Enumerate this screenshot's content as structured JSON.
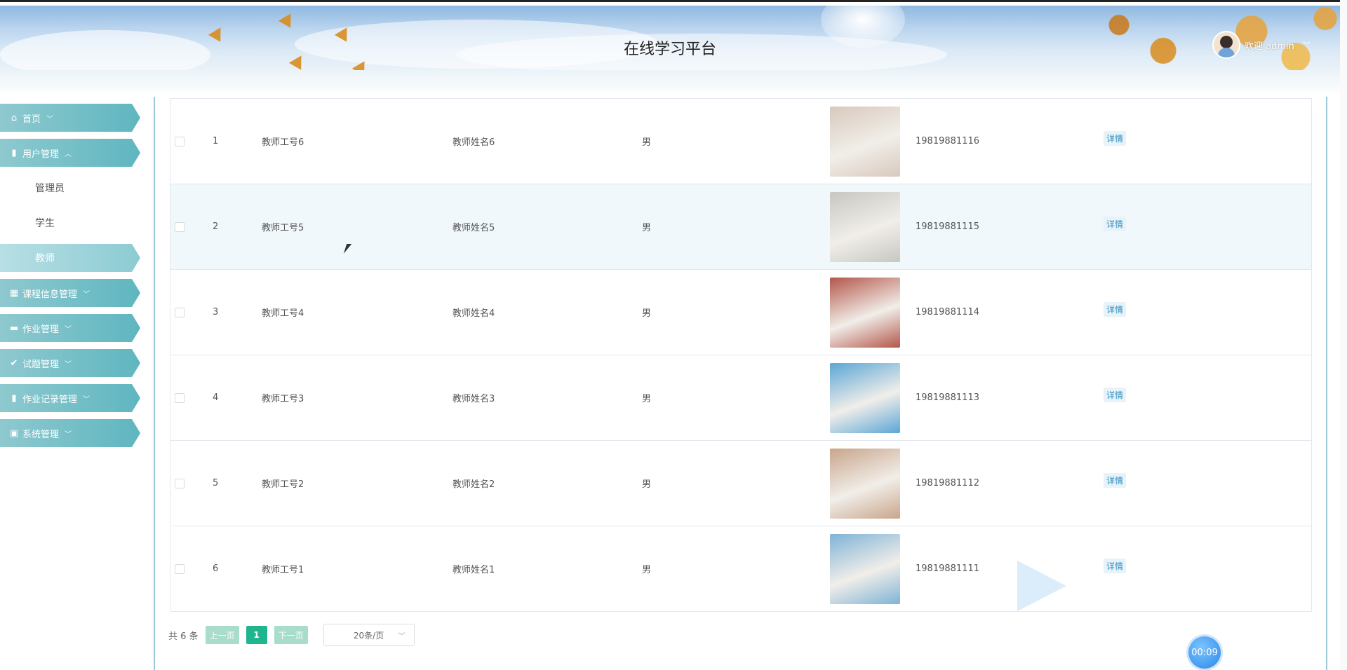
{
  "header": {
    "title": "在线学习平台",
    "welcome": "欢迎 admin"
  },
  "sidebar": {
    "items": [
      {
        "label": "首页",
        "icon": "home-icon"
      },
      {
        "label": "用户管理",
        "icon": "table-icon",
        "expanded": true,
        "children": [
          "管理员",
          "学生",
          "教师"
        ],
        "active_child": "教师"
      },
      {
        "label": "课程信息管理",
        "icon": "grid-icon"
      },
      {
        "label": "作业管理",
        "icon": "folder-icon"
      },
      {
        "label": "试题管理",
        "icon": "check-icon"
      },
      {
        "label": "作业记录管理",
        "icon": "table-icon"
      },
      {
        "label": "系统管理",
        "icon": "settings-icon"
      }
    ]
  },
  "table": {
    "rows": [
      {
        "index": "1",
        "id": "教师工号6",
        "name": "教师姓名6",
        "gender": "男",
        "phone": "19819881116",
        "action": "详情",
        "photo_color": "#d8c9bd"
      },
      {
        "index": "2",
        "id": "教师工号5",
        "name": "教师姓名5",
        "gender": "男",
        "phone": "19819881115",
        "action": "详情",
        "photo_color": "#c7c7c2"
      },
      {
        "index": "3",
        "id": "教师工号4",
        "name": "教师姓名4",
        "gender": "男",
        "phone": "19819881114",
        "action": "详情",
        "photo_color": "#b3564a"
      },
      {
        "index": "4",
        "id": "教师工号3",
        "name": "教师姓名3",
        "gender": "男",
        "phone": "19819881113",
        "action": "详情",
        "photo_color": "#5aa6d6"
      },
      {
        "index": "5",
        "id": "教师工号2",
        "name": "教师姓名2",
        "gender": "男",
        "phone": "19819881112",
        "action": "详情",
        "photo_color": "#c9a58b"
      },
      {
        "index": "6",
        "id": "教师工号1",
        "name": "教师姓名1",
        "gender": "男",
        "phone": "19819881111",
        "action": "详情",
        "photo_color": "#7fb3d6"
      }
    ]
  },
  "pager": {
    "total": "共 6 条",
    "prev": "上一页",
    "page": "1",
    "next": "下一页",
    "size": "20条/页"
  },
  "timer": "00:09"
}
